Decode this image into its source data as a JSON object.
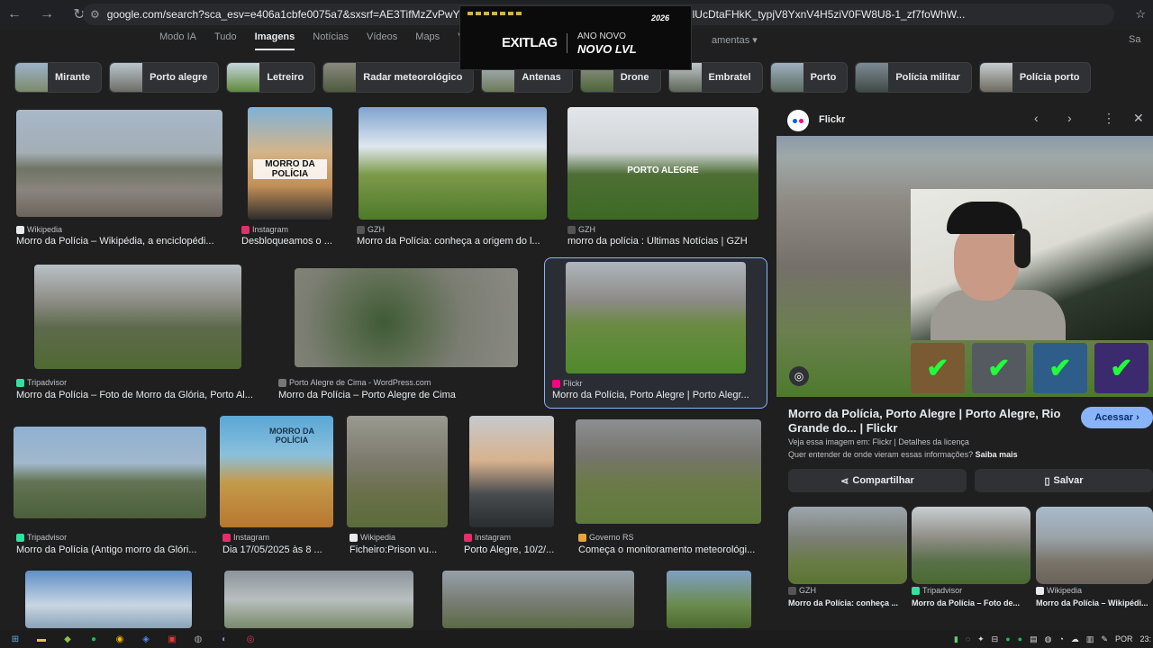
{
  "browser": {
    "url": "google.com/search?sca_esv=e406a1cbfe0075a7&sxsrf=AE3TifMzZvPwYNtzNU0Xg                                                       ydJdUtNKrM02hj0s4nbm4yAFb4PvhjlUcDtaFHkK_typjV8YxnV4H5ziV0FW8U8-1_zf7foWhW..."
  },
  "ad": {
    "logo": "EXITLAG",
    "line1": "ANO NOVO",
    "line2": "NOVO LVL",
    "year": "2026"
  },
  "tabs": [
    "Modo IA",
    "Tudo",
    "Imagens",
    "Notícias",
    "Vídeos",
    "Maps",
    "Vi"
  ],
  "tabs_more": "amentas ▾",
  "tabs_saved": "Sa",
  "chips": [
    "Mirante",
    "Porto alegre",
    "Letreiro",
    "Radar meteorológico",
    "Antenas",
    "Drone",
    "Embratel",
    "Porto",
    "Polícia militar",
    "Polícia porto"
  ],
  "results": [
    {
      "source": "Wikipedia",
      "title": "Morro da Polícia – Wikipédia, a enciclopédi..."
    },
    {
      "source": "Instagram",
      "title": "Desbloqueamos o ..."
    },
    {
      "source": "GZH",
      "title": "Morro da Polícia: conheça a origem do l..."
    },
    {
      "source": "GZH",
      "title": "morro da polícia : Últimas Notícias | GZH"
    },
    {
      "source": "Tripadvisor",
      "title": "Morro da Polícia – Foto de Morro da Glória, Porto Al..."
    },
    {
      "source": "Porto Alegre de Cima - WordPress.com",
      "title": "Morro da Polícia – Porto Alegre de Cima"
    },
    {
      "source": "Flickr",
      "title": "Morro da Polícia, Porto Alegre | Porto Alegr..."
    },
    {
      "source": "Tripadvisor",
      "title": "Morro da Polícia (Antigo morro da Glóri..."
    },
    {
      "source": "Instagram",
      "title": "Dia 17/05/2025 às 8 ..."
    },
    {
      "source": "Wikipedia",
      "title": "Ficheiro:Prison vu..."
    },
    {
      "source": "Instagram",
      "title": "Porto Alegre, 10/2/..."
    },
    {
      "source": "Governo RS",
      "title": "Começa o monitoramento meteorológi..."
    }
  ],
  "thumb_texts": {
    "morro_poster": "MORRO DA POLÍCIA",
    "porto_alegre_sign": "PORTO ALEGRE",
    "book_title": "MORRO DA POLÍCIA"
  },
  "panel": {
    "source": "Flickr",
    "title": "Morro da Polícia, Porto Alegre | Porto Alegre, Rio Grande do... | Flickr",
    "visit": "Acessar ›",
    "meta": "Veja essa imagem em: Flickr | Detalhes da licença",
    "meta2_prefix": "Quer entender de onde vieram essas informações?",
    "meta2_link": "Saiba mais",
    "share": "Compartilhar",
    "save": "Salvar",
    "related": [
      {
        "source": "GZH",
        "title": "Morro da Polícia: conheça ..."
      },
      {
        "source": "Tripadvisor",
        "title": "Morro da Polícia – Foto de..."
      },
      {
        "source": "Wikipedia",
        "title": "Morro da Polícia – Wikipédi..."
      }
    ]
  },
  "tray": {
    "lang": "POR",
    "time": "23:"
  },
  "colors": {
    "accent": "#8ab4f8",
    "background": "#1f1f1f",
    "chip_bg": "#303134"
  }
}
